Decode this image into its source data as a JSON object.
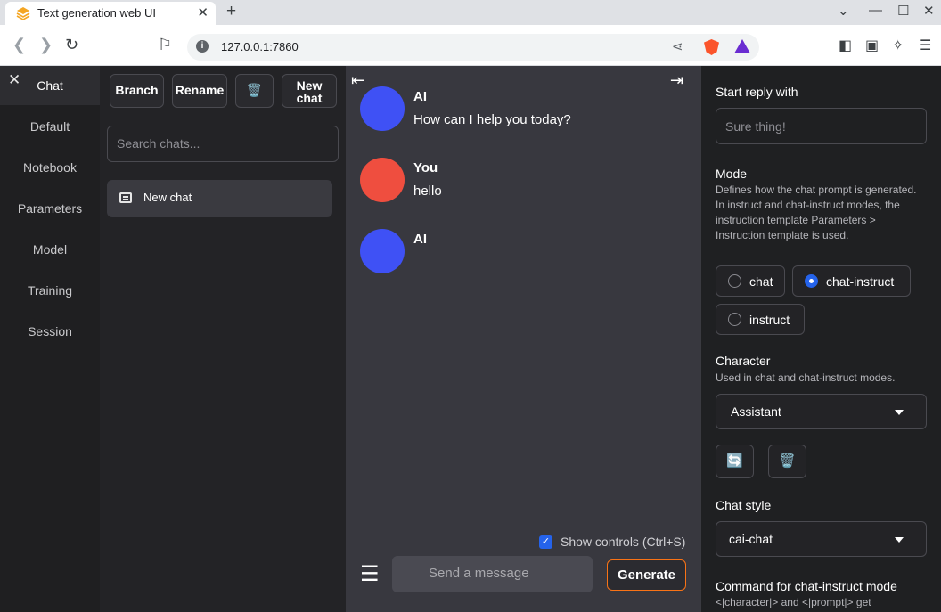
{
  "browser": {
    "tab_title": "Text generation web UI",
    "tab_close": "✕",
    "new_tab": "+",
    "url": "127.0.0.1:7860",
    "window_controls": [
      "⌄",
      "—",
      "☐",
      "✕"
    ]
  },
  "leftnav": {
    "close_glyph": "✕",
    "items": [
      "Chat",
      "Default",
      "Notebook",
      "Parameters",
      "Model",
      "Training",
      "Session"
    ]
  },
  "chatlist": {
    "branch_label": "Branch",
    "rename_label": "Rename",
    "delete_glyph": "🗑️",
    "new_chat_line1": "New",
    "new_chat_line2": "chat",
    "search_placeholder": "Search chats...",
    "entries": [
      "New chat"
    ]
  },
  "conversation": {
    "messages": [
      {
        "name": "AI",
        "text": "How can I help you today?",
        "color": "#3f51f5"
      },
      {
        "name": "You",
        "text": "hello",
        "color": "#ef4e3f"
      },
      {
        "name": "AI",
        "text": "",
        "color": "#3f51f5"
      }
    ],
    "show_controls_label": "Show controls (Ctrl+S)",
    "input_placeholder": "Send a message",
    "generate_label": "Generate"
  },
  "settings": {
    "start_reply_label": "Start reply with",
    "start_reply_placeholder": "Sure thing!",
    "mode_label": "Mode",
    "mode_info": "Defines how the chat prompt is generated. In instruct and chat-instruct modes, the instruction template Parameters > Instruction template is used.",
    "mode_options": [
      "chat",
      "chat-instruct",
      "instruct"
    ],
    "mode_selected": "chat-instruct",
    "character_label": "Character",
    "character_info": "Used in chat and chat-instruct modes.",
    "character_value": "Assistant",
    "refresh_glyph": "🔄",
    "delete_glyph": "🗑️",
    "chat_style_label": "Chat style",
    "chat_style_value": "cai-chat",
    "command_label": "Command for chat-instruct mode",
    "command_info": "<|character|> and <|prompt|> get"
  },
  "colors": {
    "accent": "#2563eb",
    "generate_border": "#f97316",
    "ai_avatar": "#3f51f5",
    "user_avatar": "#ef4e3f"
  }
}
